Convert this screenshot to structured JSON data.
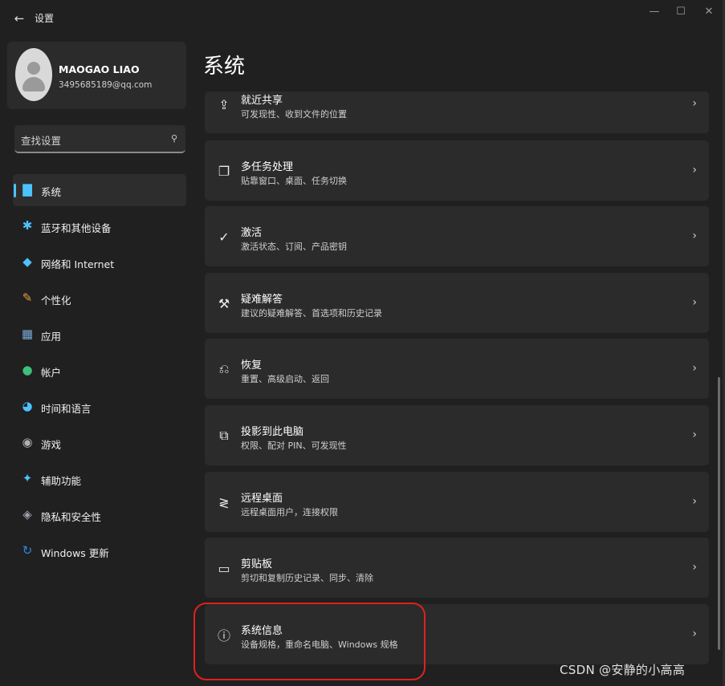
{
  "window": {
    "title": "设置",
    "back_icon": "←",
    "minimize_icon": "—",
    "maximize_icon": "☐",
    "close_icon": "✕"
  },
  "profile": {
    "name": "MAOGAO LIAO",
    "email": "3495685189@qq.com"
  },
  "search": {
    "placeholder": "查找设置",
    "icon": "⚲"
  },
  "sidebar": {
    "items": [
      {
        "label": "系统",
        "icon": "▇",
        "color": "#4cc2ff"
      },
      {
        "label": "蓝牙和其他设备",
        "icon": "✱",
        "color": "#4cc2ff"
      },
      {
        "label": "网络和 Internet",
        "icon": "◆",
        "color": "#4cc2ff"
      },
      {
        "label": "个性化",
        "icon": "✎",
        "color": "#e8a040"
      },
      {
        "label": "应用",
        "icon": "▦",
        "color": "#7aa7d8"
      },
      {
        "label": "帐户",
        "icon": "●",
        "color": "#3ec07a"
      },
      {
        "label": "时间和语言",
        "icon": "◕",
        "color": "#4cc2ff"
      },
      {
        "label": "游戏",
        "icon": "◉",
        "color": "#b0b0b0"
      },
      {
        "label": "辅助功能",
        "icon": "✦",
        "color": "#4cc2ff"
      },
      {
        "label": "隐私和安全性",
        "icon": "◈",
        "color": "#9aa0a8"
      },
      {
        "label": "Windows 更新",
        "icon": "↻",
        "color": "#2a8ae0"
      }
    ]
  },
  "main": {
    "title": "系统",
    "cards": [
      {
        "title": "就近共享",
        "subtitle": "可发现性、收到文件的位置",
        "icon": "⇪"
      },
      {
        "title": "多任务处理",
        "subtitle": "贴靠窗口、桌面、任务切换",
        "icon": "❐"
      },
      {
        "title": "激活",
        "subtitle": "激活状态、订阅、产品密钥",
        "icon": "✓"
      },
      {
        "title": "疑难解答",
        "subtitle": "建议的疑难解答、首选项和历史记录",
        "icon": "⚒"
      },
      {
        "title": "恢复",
        "subtitle": "重置、高级启动、返回",
        "icon": "⎌"
      },
      {
        "title": "投影到此电脑",
        "subtitle": "权限、配对 PIN、可发现性",
        "icon": "⧉"
      },
      {
        "title": "远程桌面",
        "subtitle": "远程桌面用户，连接权限",
        "icon": "≷"
      },
      {
        "title": "剪贴板",
        "subtitle": "剪切和复制历史记录、同步、清除",
        "icon": "▭"
      },
      {
        "title": "系统信息",
        "subtitle": "设备规格，重命名电脑、Windows 规格",
        "icon": "ⓘ"
      }
    ],
    "chevron": "›"
  },
  "watermark": "CSDN @安静的小高高"
}
